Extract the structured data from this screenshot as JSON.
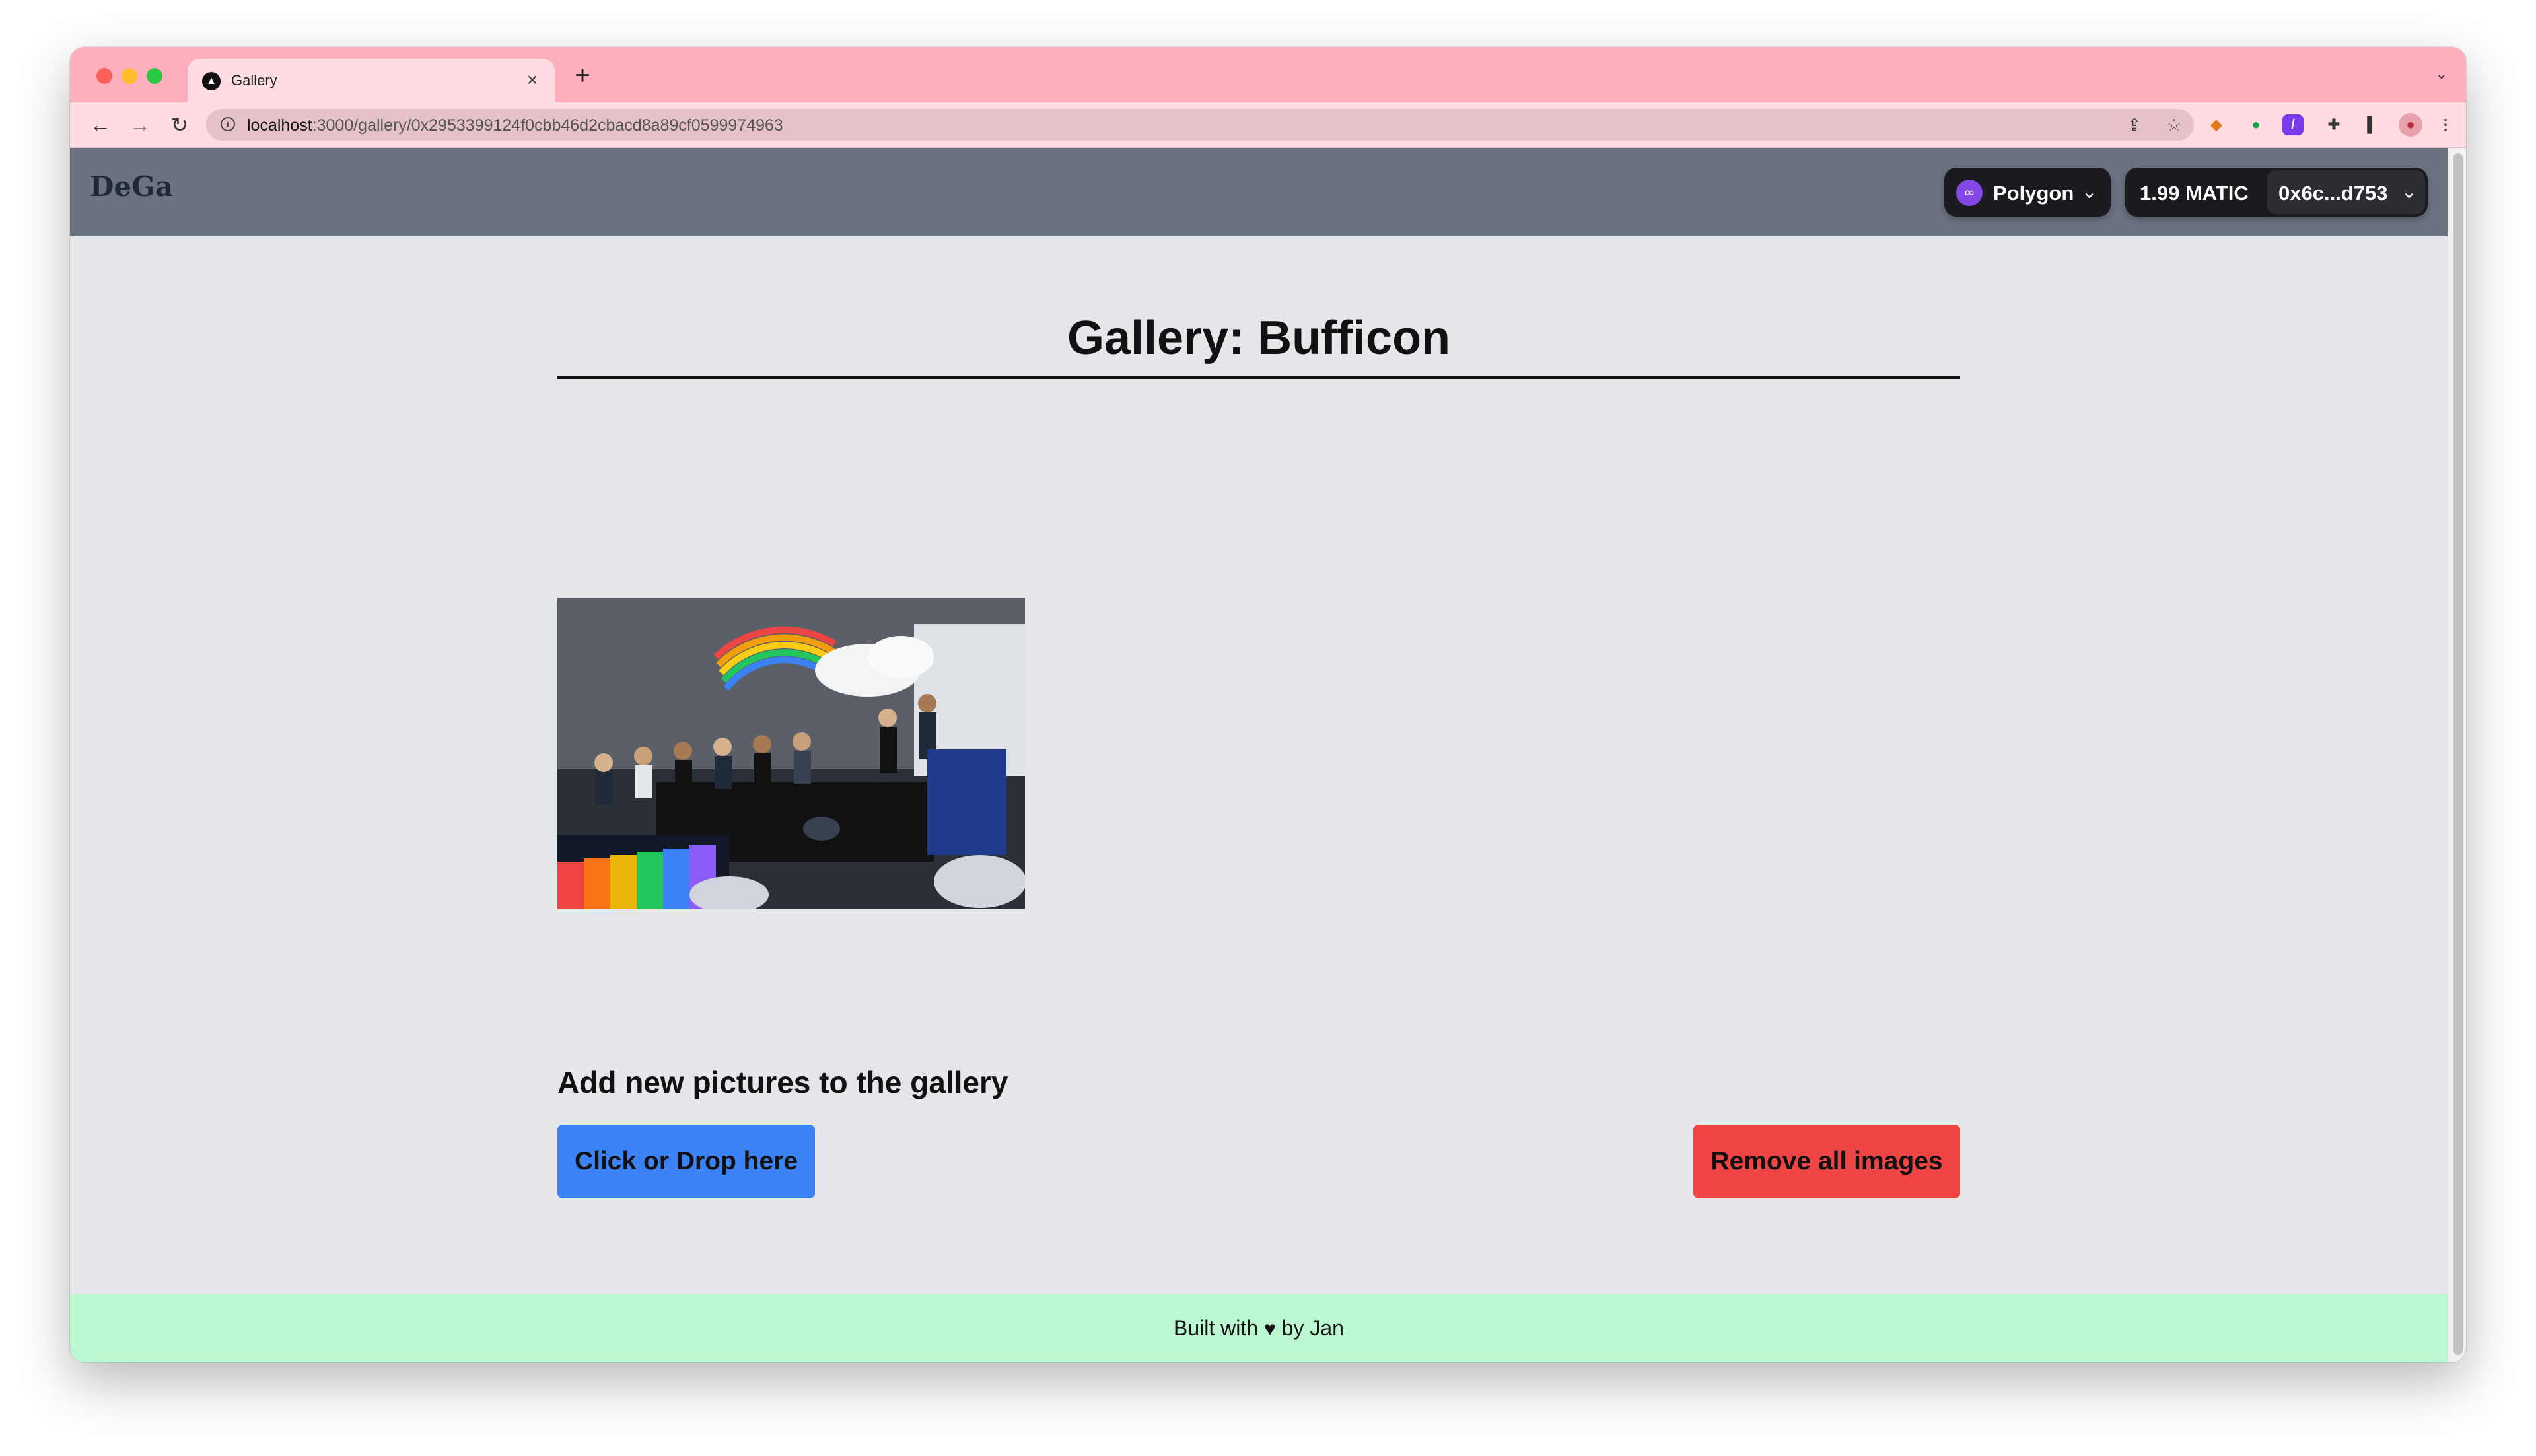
{
  "browser": {
    "tab_title": "Gallery",
    "tab_favicon": "dega-triangle-icon",
    "url_host": "localhost",
    "url_path": ":3000/gallery/0x2953399124f0cbb46d2cbacd8a89cf0599974963"
  },
  "app": {
    "brand": "DeGa",
    "network": {
      "label": "Polygon"
    },
    "account": {
      "balance": "1.99 MATIC",
      "address": "0x6c...d753"
    }
  },
  "gallery": {
    "title": "Gallery: Bufficon",
    "images": [
      {
        "alt": "Panel discussion on a stage with rainbow backdrop"
      }
    ]
  },
  "upload": {
    "heading": "Add new pictures to the gallery",
    "upload_label": "Click or Drop here",
    "remove_label": "Remove all images"
  },
  "footer": {
    "prefix": "Built with",
    "suffix": "by Jan",
    "heart": "♥"
  },
  "colors": {
    "tabbar": "#ffafbd",
    "toolbar": "#ffdce2",
    "nav": "#6b7280",
    "page": "#e5e7eb",
    "upload_button": "#3b82f6",
    "remove_button": "#ef4444",
    "footer": "#bbf7d0"
  }
}
